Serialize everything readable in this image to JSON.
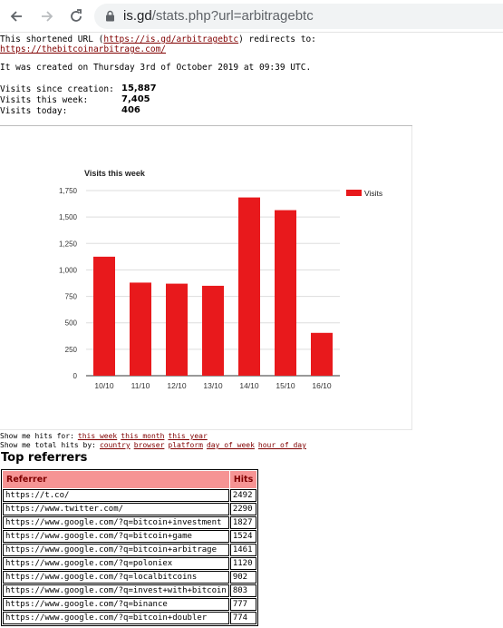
{
  "browser": {
    "url_host": "is.gd",
    "url_rest": "/stats.php?url=arbitragebtc"
  },
  "page": {
    "redirect_prefix": "This shortened URL (",
    "short_url": "https://is.gd/arbitragebtc",
    "redirect_suffix": ") redirects to:",
    "target_url": "https://thebitcoinarbitrage.com/",
    "created": "It was created on Thursday 3rd of October 2019 at 09:39 UTC.",
    "stats": [
      {
        "label": "Visits since creation:",
        "value": "15,887"
      },
      {
        "label": "Visits this week:",
        "value": "7,405"
      },
      {
        "label": "Visits today:",
        "value": "406"
      }
    ],
    "show_hits_label": "Show me hits for:",
    "show_hits_links": [
      "this week",
      "this month",
      "this year"
    ],
    "show_total_label": "Show me total hits by:",
    "show_total_links": [
      "country",
      "browser",
      "platform",
      "day of week",
      "hour of day"
    ],
    "top_referrers_title": "Top referrers",
    "table": {
      "headers": [
        "Referrer",
        "Hits"
      ],
      "rows": [
        [
          "https://t.co/",
          "2492"
        ],
        [
          "https://www.twitter.com/",
          "2290"
        ],
        [
          "https://www.google.com/?q=bitcoin+investment",
          "1827"
        ],
        [
          "https://www.google.com/?q=bitcoin+game",
          "1524"
        ],
        [
          "https://www.google.com/?q=bitcoin+arbitrage",
          "1461"
        ],
        [
          "https://www.google.com/?q=poloniex",
          "1120"
        ],
        [
          "https://www.google.com/?q=localbitcoins",
          "902"
        ],
        [
          "https://www.google.com/?q=invest+with+bitcoin",
          "803"
        ],
        [
          "https://www.google.com/?q=binance",
          "777"
        ],
        [
          "https://www.google.com/?q=bitcoin+doubler",
          "774"
        ]
      ]
    }
  },
  "chart_data": {
    "type": "bar",
    "title": "Visits this week",
    "categories": [
      "10/10",
      "11/10",
      "12/10",
      "13/10",
      "14/10",
      "15/10",
      "16/10"
    ],
    "series": [
      {
        "name": "Visits",
        "values": [
          1125,
          880,
          870,
          850,
          1685,
          1565,
          405
        ]
      }
    ],
    "yticks": [
      "0",
      "250",
      "500",
      "750",
      "1,000",
      "1,250",
      "1,500",
      "1,750"
    ],
    "ylim": [
      0,
      1750
    ],
    "bar_color": "#e8191c",
    "grid": true,
    "legend": "right"
  }
}
